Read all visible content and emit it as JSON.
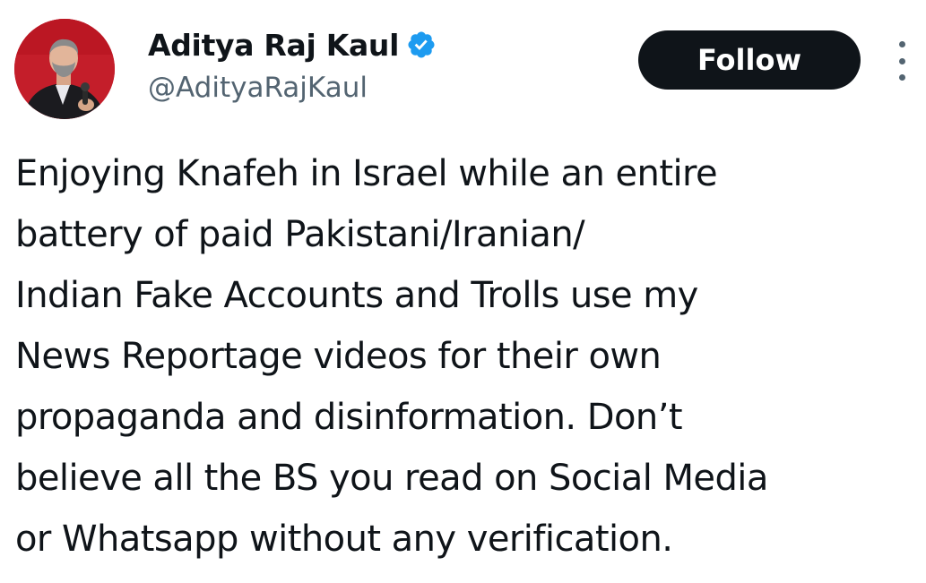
{
  "author": {
    "display_name": "Aditya Raj Kaul",
    "handle": "@AdityaRajKaul",
    "verified": true,
    "avatar_icon": "profile-photo"
  },
  "actions": {
    "follow_label": "Follow",
    "more_icon": "vertical-ellipsis-icon"
  },
  "tweet": {
    "lines": [
      "Enjoying Knafeh in Israel while an entire",
      "battery of paid Pakistani/Iranian/",
      "Indian Fake Accounts and Trolls use my",
      "News Reportage videos for their own",
      "propaganda and disinformation. Don’t",
      "believe all the BS you read on Social Media",
      "or Whatsapp without any verification."
    ]
  },
  "colors": {
    "text": "#0f1419",
    "secondary_text": "#536471",
    "follow_bg": "#0f1419",
    "verified_badge": "#1d9bf0",
    "avatar_bg": "#c8102e"
  }
}
